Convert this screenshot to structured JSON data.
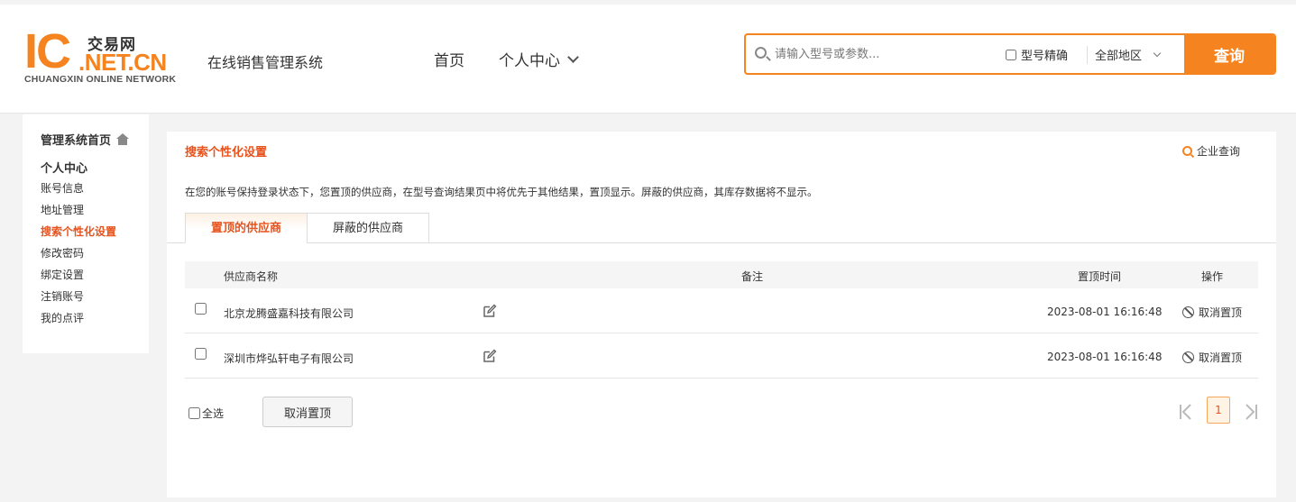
{
  "header": {
    "logo": {
      "ic": "IC",
      "cn": "交易网",
      "net": ".NET.CN",
      "en": "CHUANGXIN ONLINE NETWORK"
    },
    "system_title": "在线销售管理系统",
    "nav": {
      "home": "首页",
      "user_center": "个人中心"
    },
    "search": {
      "placeholder": "请输入型号或参数...",
      "value": "",
      "exact_label": "型号精确",
      "region": "全部地区",
      "button": "查询"
    }
  },
  "sidebar": {
    "home": "管理系统首页",
    "section": "个人中心",
    "items": [
      {
        "label": "账号信息",
        "active": false
      },
      {
        "label": "地址管理",
        "active": false
      },
      {
        "label": "搜索个性化设置",
        "active": true
      },
      {
        "label": "修改密码",
        "active": false
      },
      {
        "label": "绑定设置",
        "active": false
      },
      {
        "label": "注销账号",
        "active": false
      },
      {
        "label": "我的点评",
        "active": false
      }
    ]
  },
  "main": {
    "title": "搜索个性化设置",
    "company_query": "企业查询",
    "description": "在您的账号保持登录状态下，您置顶的供应商，在型号查询结果页中将优先于其他结果，置顶显示。屏蔽的供应商，其库存数据将不显示。",
    "tabs": [
      {
        "label": "置顶的供应商",
        "active": true
      },
      {
        "label": "屏蔽的供应商",
        "active": false
      }
    ],
    "table": {
      "columns": {
        "name": "供应商名称",
        "remark": "备注",
        "time": "置顶时间",
        "op": "操作"
      },
      "rows": [
        {
          "name": "北京龙腾盛嘉科技有限公司",
          "time": "2023-08-01 16:16:48",
          "action": "取消置顶"
        },
        {
          "name": "深圳市烨弘轩电子有限公司",
          "time": "2023-08-01 16:16:48",
          "action": "取消置顶"
        }
      ]
    },
    "footer": {
      "select_all": "全选",
      "bulk_cancel": "取消置顶"
    },
    "pagination": {
      "current": "1"
    }
  },
  "colors": {
    "accent": "#f5831f",
    "active_text": "#e8521c"
  }
}
